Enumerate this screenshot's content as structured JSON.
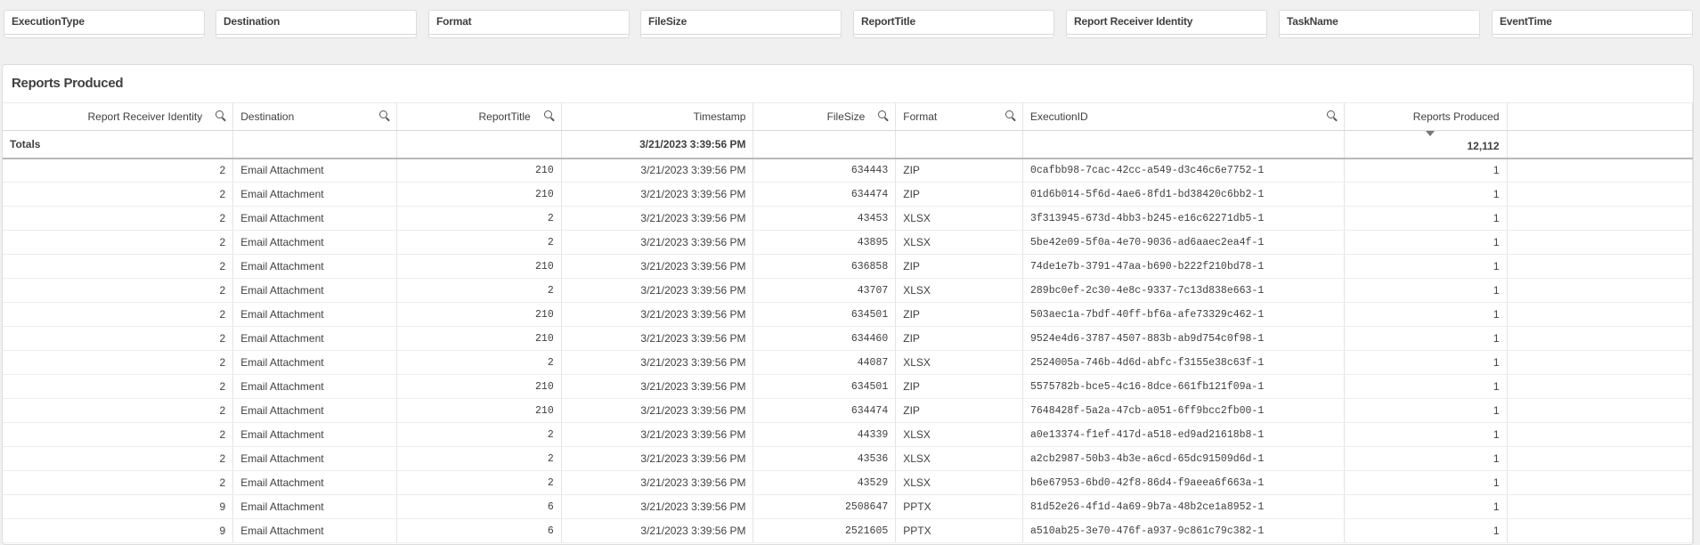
{
  "filters": [
    "ExecutionType",
    "Destination",
    "Format",
    "FileSize",
    "ReportTitle",
    "Report Receiver Identity",
    "TaskName",
    "EventTime"
  ],
  "panel": {
    "title": "Reports Produced"
  },
  "table": {
    "headers": [
      "Report Receiver Identity",
      "Destination",
      "ReportTitle",
      "Timestamp",
      "FileSize",
      "Format",
      "ExecutionID",
      "Reports Produced"
    ],
    "totals": {
      "label": "Totals",
      "timestamp": "3/21/2023 3:39:56 PM",
      "reports_produced": "12,112"
    },
    "rows": [
      [
        "2",
        "Email Attachment",
        "210",
        "3/21/2023 3:39:56 PM",
        "634443",
        "ZIP",
        "0cafbb98-7cac-42cc-a549-d3c46c6e7752-1",
        "1"
      ],
      [
        "2",
        "Email Attachment",
        "210",
        "3/21/2023 3:39:56 PM",
        "634474",
        "ZIP",
        "01d6b014-5f6d-4ae6-8fd1-bd38420c6bb2-1",
        "1"
      ],
      [
        "2",
        "Email Attachment",
        "2",
        "3/21/2023 3:39:56 PM",
        "43453",
        "XLSX",
        "3f313945-673d-4bb3-b245-e16c62271db5-1",
        "1"
      ],
      [
        "2",
        "Email Attachment",
        "2",
        "3/21/2023 3:39:56 PM",
        "43895",
        "XLSX",
        "5be42e09-5f0a-4e70-9036-ad6aaec2ea4f-1",
        "1"
      ],
      [
        "2",
        "Email Attachment",
        "210",
        "3/21/2023 3:39:56 PM",
        "636858",
        "ZIP",
        "74de1e7b-3791-47aa-b690-b222f210bd78-1",
        "1"
      ],
      [
        "2",
        "Email Attachment",
        "2",
        "3/21/2023 3:39:56 PM",
        "43707",
        "XLSX",
        "289bc0ef-2c30-4e8c-9337-7c13d838e663-1",
        "1"
      ],
      [
        "2",
        "Email Attachment",
        "210",
        "3/21/2023 3:39:56 PM",
        "634501",
        "ZIP",
        "503aec1a-7bdf-40ff-bf6a-afe73329c462-1",
        "1"
      ],
      [
        "2",
        "Email Attachment",
        "210",
        "3/21/2023 3:39:56 PM",
        "634460",
        "ZIP",
        "9524e4d6-3787-4507-883b-ab9d754c0f98-1",
        "1"
      ],
      [
        "2",
        "Email Attachment",
        "2",
        "3/21/2023 3:39:56 PM",
        "44087",
        "XLSX",
        "2524005a-746b-4d6d-abfc-f3155e38c63f-1",
        "1"
      ],
      [
        "2",
        "Email Attachment",
        "210",
        "3/21/2023 3:39:56 PM",
        "634501",
        "ZIP",
        "5575782b-bce5-4c16-8dce-661fb121f09a-1",
        "1"
      ],
      [
        "2",
        "Email Attachment",
        "210",
        "3/21/2023 3:39:56 PM",
        "634474",
        "ZIP",
        "7648428f-5a2a-47cb-a051-6ff9bcc2fb00-1",
        "1"
      ],
      [
        "2",
        "Email Attachment",
        "2",
        "3/21/2023 3:39:56 PM",
        "44339",
        "XLSX",
        "a0e13374-f1ef-417d-a518-ed9ad21618b8-1",
        "1"
      ],
      [
        "2",
        "Email Attachment",
        "2",
        "3/21/2023 3:39:56 PM",
        "43536",
        "XLSX",
        "a2cb2987-50b3-4b3e-a6cd-65dc91509d6d-1",
        "1"
      ],
      [
        "2",
        "Email Attachment",
        "2",
        "3/21/2023 3:39:56 PM",
        "43529",
        "XLSX",
        "b6e67953-6bd0-42f8-86d4-f9aeea6f663a-1",
        "1"
      ],
      [
        "9",
        "Email Attachment",
        "6",
        "3/21/2023 3:39:56 PM",
        "2508647",
        "PPTX",
        "81d52e26-4f1d-4a69-9b7a-48b2ce1a8952-1",
        "1"
      ],
      [
        "9",
        "Email Attachment",
        "6",
        "3/21/2023 3:39:56 PM",
        "2521605",
        "PPTX",
        "a510ab25-3e70-476f-a937-9c861c79c382-1",
        "1"
      ]
    ]
  }
}
